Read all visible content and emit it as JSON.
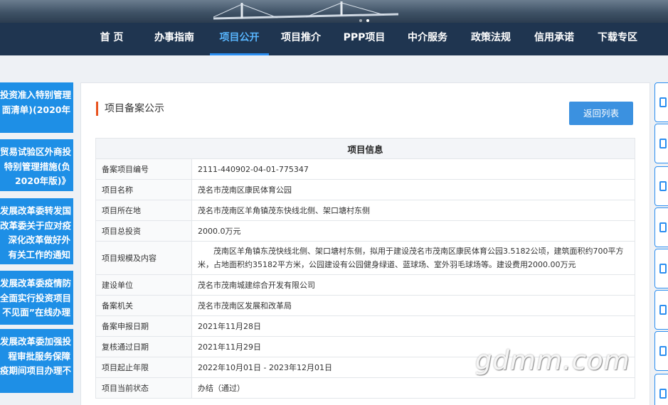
{
  "nav": {
    "items": [
      {
        "label": "首 页"
      },
      {
        "label": "办事指南"
      },
      {
        "label": "项目公开"
      },
      {
        "label": "项目推介"
      },
      {
        "label": "PPP项目"
      },
      {
        "label": "中介服务"
      },
      {
        "label": "政策法规"
      },
      {
        "label": "信用承诺"
      },
      {
        "label": "下载专区"
      }
    ],
    "active_index": 2
  },
  "sidebar": {
    "cards": [
      {
        "lines": [
          "投资准入特别管理",
          "面清单)(2020年"
        ]
      },
      {
        "lines": [
          "贸易试验区外商投",
          "特别管理措施(负",
          "2020年版)》"
        ]
      },
      {
        "lines": [
          "发展改革委转发国",
          "改革委关于应对疫",
          "深化改革做好外",
          "有关工作的通知"
        ]
      },
      {
        "lines": [
          "发展改革委疫情防",
          "全面实行投资项目",
          "不见面”在线办理"
        ]
      },
      {
        "lines": [
          "发展改革委加强投",
          "程审批服务保障",
          "疫期间项目办理不"
        ]
      }
    ]
  },
  "panel": {
    "title": "项目备案公示",
    "back_button": "返回列表",
    "table_heading": "项目信息",
    "rows": [
      {
        "label": "备案项目编号",
        "value": "2111-440902-04-01-775347"
      },
      {
        "label": "项目名称",
        "value": "茂名市茂南区康民体育公园"
      },
      {
        "label": "项目所在地",
        "value": "茂名市茂南区羊角镇茂东快线北侧、架口塘村东侧"
      },
      {
        "label": "项目总投资",
        "value": "2000.0万元"
      },
      {
        "label": "项目规模及内容",
        "value": "茂南区羊角镇东茂快线北侧、架口塘村东侧，拟用于建设茂名市茂南区康民体育公园3.5182公顷，建筑面积约700平方米，占地面积约35182平方米，公园建设有公园健身绿道、蓝球场、室外羽毛球场等。建设费用2000.00万元"
      },
      {
        "label": "建设单位",
        "value": "茂名市茂南城建综合开发有限公司"
      },
      {
        "label": "备案机关",
        "value": "茂名市茂南区发展和改革局"
      },
      {
        "label": "备案申报日期",
        "value": "2021年11月28日"
      },
      {
        "label": "复核通过日期",
        "value": "2021年11月29日"
      },
      {
        "label": "项目起止年限",
        "value": "2022年10月01日 - 2023年12月01日"
      },
      {
        "label": "项目当前状态",
        "value": "办结（通过）"
      }
    ]
  },
  "watermark": "gdmm.com",
  "colors": {
    "nav_bg": "#1f3550",
    "accent": "#2b8ef0",
    "card_bg": "#1e8fe6",
    "title_bar": "#e8531f"
  }
}
